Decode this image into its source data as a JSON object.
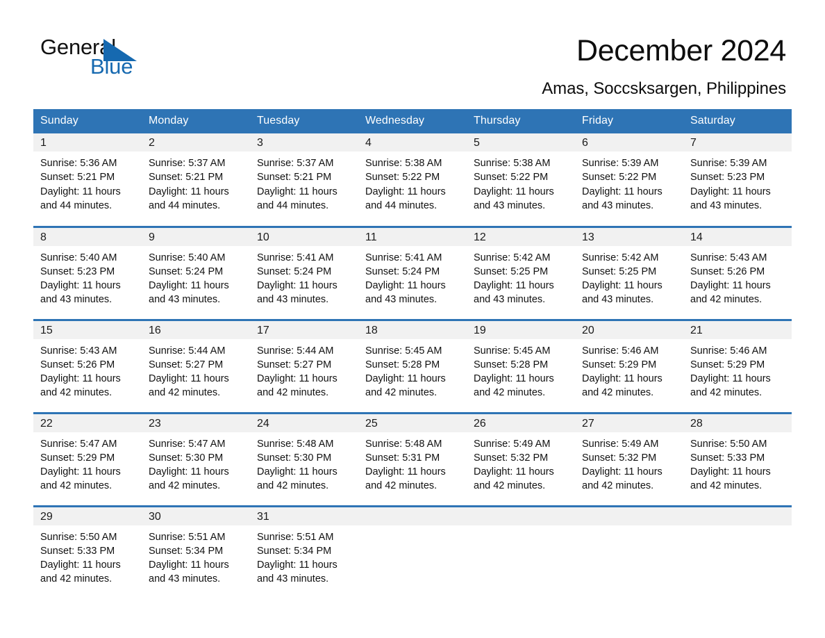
{
  "brand": {
    "name_part1": "General",
    "name_part2": "Blue",
    "triangle_icon": "triangle-logo-icon",
    "accent_color": "#1669b0"
  },
  "header": {
    "month_title": "December 2024",
    "location": "Amas, Soccsksargen, Philippines"
  },
  "colors": {
    "header_band": "#2e74b5",
    "day_band": "#f1f1f1",
    "row_separator": "#2e74b5",
    "text": "#111111"
  },
  "calendar": {
    "weekday_headers": [
      "Sunday",
      "Monday",
      "Tuesday",
      "Wednesday",
      "Thursday",
      "Friday",
      "Saturday"
    ],
    "weeks": [
      [
        {
          "day": "1",
          "sunrise": "Sunrise: 5:36 AM",
          "sunset": "Sunset: 5:21 PM",
          "daylight": "Daylight: 11 hours and 44 minutes."
        },
        {
          "day": "2",
          "sunrise": "Sunrise: 5:37 AM",
          "sunset": "Sunset: 5:21 PM",
          "daylight": "Daylight: 11 hours and 44 minutes."
        },
        {
          "day": "3",
          "sunrise": "Sunrise: 5:37 AM",
          "sunset": "Sunset: 5:21 PM",
          "daylight": "Daylight: 11 hours and 44 minutes."
        },
        {
          "day": "4",
          "sunrise": "Sunrise: 5:38 AM",
          "sunset": "Sunset: 5:22 PM",
          "daylight": "Daylight: 11 hours and 44 minutes."
        },
        {
          "day": "5",
          "sunrise": "Sunrise: 5:38 AM",
          "sunset": "Sunset: 5:22 PM",
          "daylight": "Daylight: 11 hours and 43 minutes."
        },
        {
          "day": "6",
          "sunrise": "Sunrise: 5:39 AM",
          "sunset": "Sunset: 5:22 PM",
          "daylight": "Daylight: 11 hours and 43 minutes."
        },
        {
          "day": "7",
          "sunrise": "Sunrise: 5:39 AM",
          "sunset": "Sunset: 5:23 PM",
          "daylight": "Daylight: 11 hours and 43 minutes."
        }
      ],
      [
        {
          "day": "8",
          "sunrise": "Sunrise: 5:40 AM",
          "sunset": "Sunset: 5:23 PM",
          "daylight": "Daylight: 11 hours and 43 minutes."
        },
        {
          "day": "9",
          "sunrise": "Sunrise: 5:40 AM",
          "sunset": "Sunset: 5:24 PM",
          "daylight": "Daylight: 11 hours and 43 minutes."
        },
        {
          "day": "10",
          "sunrise": "Sunrise: 5:41 AM",
          "sunset": "Sunset: 5:24 PM",
          "daylight": "Daylight: 11 hours and 43 minutes."
        },
        {
          "day": "11",
          "sunrise": "Sunrise: 5:41 AM",
          "sunset": "Sunset: 5:24 PM",
          "daylight": "Daylight: 11 hours and 43 minutes."
        },
        {
          "day": "12",
          "sunrise": "Sunrise: 5:42 AM",
          "sunset": "Sunset: 5:25 PM",
          "daylight": "Daylight: 11 hours and 43 minutes."
        },
        {
          "day": "13",
          "sunrise": "Sunrise: 5:42 AM",
          "sunset": "Sunset: 5:25 PM",
          "daylight": "Daylight: 11 hours and 43 minutes."
        },
        {
          "day": "14",
          "sunrise": "Sunrise: 5:43 AM",
          "sunset": "Sunset: 5:26 PM",
          "daylight": "Daylight: 11 hours and 42 minutes."
        }
      ],
      [
        {
          "day": "15",
          "sunrise": "Sunrise: 5:43 AM",
          "sunset": "Sunset: 5:26 PM",
          "daylight": "Daylight: 11 hours and 42 minutes."
        },
        {
          "day": "16",
          "sunrise": "Sunrise: 5:44 AM",
          "sunset": "Sunset: 5:27 PM",
          "daylight": "Daylight: 11 hours and 42 minutes."
        },
        {
          "day": "17",
          "sunrise": "Sunrise: 5:44 AM",
          "sunset": "Sunset: 5:27 PM",
          "daylight": "Daylight: 11 hours and 42 minutes."
        },
        {
          "day": "18",
          "sunrise": "Sunrise: 5:45 AM",
          "sunset": "Sunset: 5:28 PM",
          "daylight": "Daylight: 11 hours and 42 minutes."
        },
        {
          "day": "19",
          "sunrise": "Sunrise: 5:45 AM",
          "sunset": "Sunset: 5:28 PM",
          "daylight": "Daylight: 11 hours and 42 minutes."
        },
        {
          "day": "20",
          "sunrise": "Sunrise: 5:46 AM",
          "sunset": "Sunset: 5:29 PM",
          "daylight": "Daylight: 11 hours and 42 minutes."
        },
        {
          "day": "21",
          "sunrise": "Sunrise: 5:46 AM",
          "sunset": "Sunset: 5:29 PM",
          "daylight": "Daylight: 11 hours and 42 minutes."
        }
      ],
      [
        {
          "day": "22",
          "sunrise": "Sunrise: 5:47 AM",
          "sunset": "Sunset: 5:29 PM",
          "daylight": "Daylight: 11 hours and 42 minutes."
        },
        {
          "day": "23",
          "sunrise": "Sunrise: 5:47 AM",
          "sunset": "Sunset: 5:30 PM",
          "daylight": "Daylight: 11 hours and 42 minutes."
        },
        {
          "day": "24",
          "sunrise": "Sunrise: 5:48 AM",
          "sunset": "Sunset: 5:30 PM",
          "daylight": "Daylight: 11 hours and 42 minutes."
        },
        {
          "day": "25",
          "sunrise": "Sunrise: 5:48 AM",
          "sunset": "Sunset: 5:31 PM",
          "daylight": "Daylight: 11 hours and 42 minutes."
        },
        {
          "day": "26",
          "sunrise": "Sunrise: 5:49 AM",
          "sunset": "Sunset: 5:32 PM",
          "daylight": "Daylight: 11 hours and 42 minutes."
        },
        {
          "day": "27",
          "sunrise": "Sunrise: 5:49 AM",
          "sunset": "Sunset: 5:32 PM",
          "daylight": "Daylight: 11 hours and 42 minutes."
        },
        {
          "day": "28",
          "sunrise": "Sunrise: 5:50 AM",
          "sunset": "Sunset: 5:33 PM",
          "daylight": "Daylight: 11 hours and 42 minutes."
        }
      ],
      [
        {
          "day": "29",
          "sunrise": "Sunrise: 5:50 AM",
          "sunset": "Sunset: 5:33 PM",
          "daylight": "Daylight: 11 hours and 42 minutes."
        },
        {
          "day": "30",
          "sunrise": "Sunrise: 5:51 AM",
          "sunset": "Sunset: 5:34 PM",
          "daylight": "Daylight: 11 hours and 43 minutes."
        },
        {
          "day": "31",
          "sunrise": "Sunrise: 5:51 AM",
          "sunset": "Sunset: 5:34 PM",
          "daylight": "Daylight: 11 hours and 43 minutes."
        },
        {
          "day": "",
          "sunrise": "",
          "sunset": "",
          "daylight": ""
        },
        {
          "day": "",
          "sunrise": "",
          "sunset": "",
          "daylight": ""
        },
        {
          "day": "",
          "sunrise": "",
          "sunset": "",
          "daylight": ""
        },
        {
          "day": "",
          "sunrise": "",
          "sunset": "",
          "daylight": ""
        }
      ]
    ]
  }
}
